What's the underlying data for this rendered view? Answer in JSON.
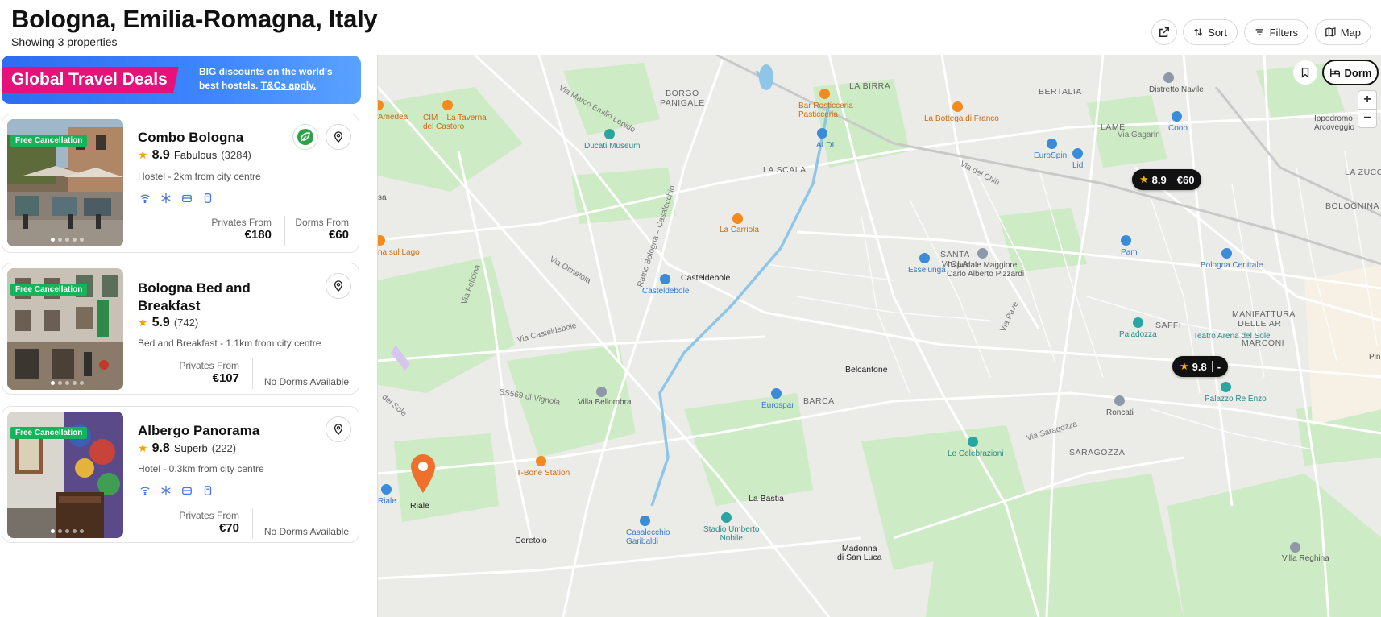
{
  "header": {
    "title": "Bologna, Emilia-Romagna, Italy",
    "subtitle": "Showing 3 properties",
    "buttons": {
      "share_icon": "share-icon",
      "sort": "Sort",
      "filters": "Filters",
      "map": "Map"
    }
  },
  "promo": {
    "tag": "Global Travel Deals",
    "text": "BIG discounts on the world's best hostels.",
    "link": "T&Cs apply."
  },
  "properties": [
    {
      "badge": "Free Cancellation",
      "name": "Combo Bologna",
      "score": "8.9",
      "label": "Fabulous",
      "reviews": "(3284)",
      "meta": "Hostel - 2km from city centre",
      "amenities": [
        "wifi-icon",
        "snowflake-icon",
        "linen-icon",
        "locker-icon"
      ],
      "privates_label": "Privates From",
      "privates_price": "€180",
      "dorms_label": "Dorms From",
      "dorms_price": "€60",
      "sustainable_icon": "leaf-badge-icon"
    },
    {
      "badge": "Free Cancellation",
      "name": "Bologna Bed and Breakfast",
      "score": "5.9",
      "label": "",
      "reviews": "(742)",
      "meta": "Bed and Breakfast - 1.1km from city centre",
      "privates_label": "Privates From",
      "privates_price": "€107",
      "no_dorms": "No Dorms Available"
    },
    {
      "badge": "Free Cancellation",
      "name": "Albergo Panorama",
      "score": "9.8",
      "label": "Superb",
      "reviews": "(222)",
      "meta": "Hotel - 0.3km from city centre",
      "amenities": [
        "wifi-icon",
        "snowflake-icon",
        "linen-icon",
        "locker-icon"
      ],
      "privates_label": "Privates From",
      "privates_price": "€70",
      "no_dorms": "No Dorms Available"
    }
  ],
  "map": {
    "dorm_toggle": "Dorm",
    "zoom_in": "+",
    "zoom_out": "−",
    "markers": [
      {
        "score": "8.9",
        "price": "€60"
      },
      {
        "score": "9.8",
        "price": "-"
      }
    ],
    "labels": {
      "borgo_panigale": "BORGO\nPANIGALE",
      "la_birra": "LA BIRRA",
      "bertalia": "BERTALIA",
      "lame": "LAME",
      "la_scala": "LA SCALA",
      "santa_viola": "SANTA\nVIOLA",
      "saffi": "SAFFI",
      "manifattura": "MANIFATTURA\nDELLE ARTI",
      "marconi": "MARCONI",
      "bolognina": "BOLOGNINA",
      "barca": "BARCA",
      "saragozza": "SARAGOZZA",
      "la_zucca": "LA ZUCC",
      "amedea": "Amedea",
      "cim": "CIM – La Taverna\ndel Castoro",
      "ducati": "Ducati Museum",
      "bar_rosticceria": "Bar Rosticceria\nPasticceria",
      "aldi": "ALDI",
      "la_bottega": "La Bottega di Franco",
      "distretto": "Distretto Navile",
      "coop": "Coop",
      "eurospin": "EuroSpin",
      "lidl": "Lidl",
      "ippodromo": "Ippodromo\nArcoveggio",
      "via_gagarin": "Via Gagarin",
      "via_del_chiu": "Via del Chiù",
      "via_marco": "Via Marco Emilio Lepido",
      "sa": "sa",
      "la_carriola": "La Carriola",
      "pam": "Pam",
      "bologna_centrale": "Bologna Centrale",
      "na_sul_lago": "na sul Lago",
      "esselunga": "Esselunga",
      "ospedale": "Ospedale Maggiore\nCarlo Alberto Pizzardi",
      "casteldebole": "Casteldebole",
      "casteldebole_st": "Casteldebole",
      "via_olmetola": "Via Olmetola",
      "via_felicina": "Via Felicina",
      "ramo_bologna": "Ramo Bologna – Casalecchio",
      "via_pave": "Via Pave",
      "paladozza": "Paladozza",
      "teatro": "Teatro Arena del Sole",
      "via_casteldebole": "Via Casteldebole",
      "villa_bellombra": "Villa Bellombra",
      "belcantone": "Belcantone",
      "eurospar": "Eurospar",
      "roncati": "Roncati",
      "palazzo": "Palazzo Re Enzo",
      "via_saragozza": "Via Saragozza",
      "ss569": "SS569 di Vignola",
      "del_sole": "del Sole",
      "le_celebrazioni": "Le Celebrazioni",
      "tbone": "T-Bone Station",
      "riale_st": "Riale",
      "riale": "Riale",
      "la_bastia": "La Bastia",
      "stadio": "Stadio Umberto\nNobile",
      "casalecchio": "Casalecchio\nGaribaldi",
      "ceretolo": "Ceretolo",
      "madonna": "Madonna\ndi San Luca",
      "villa_reghina": "Villa Reghina",
      "pina": "Pina"
    }
  }
}
